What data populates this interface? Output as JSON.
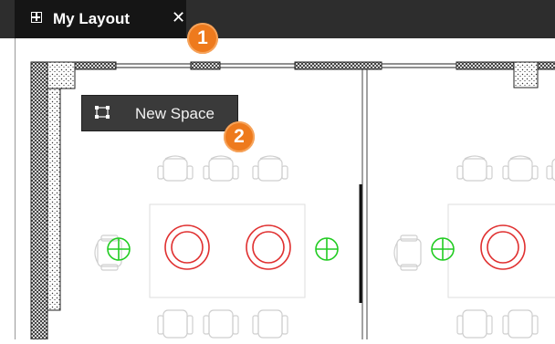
{
  "tab": {
    "title": "My Layout",
    "close_glyph": "✕",
    "icon": "layout-icon"
  },
  "tooltip": {
    "label": "New Space",
    "icon": "space-bracket-icon"
  },
  "callouts": {
    "first": "1",
    "second": "2"
  },
  "colors": {
    "tab_bar": "#2d2d2d",
    "active_tab": "#151515",
    "callout": "#ee7a1d",
    "table_symbol": "#e03030",
    "crosshair": "#22cc22",
    "furniture_outline": "#c8c8c8"
  }
}
